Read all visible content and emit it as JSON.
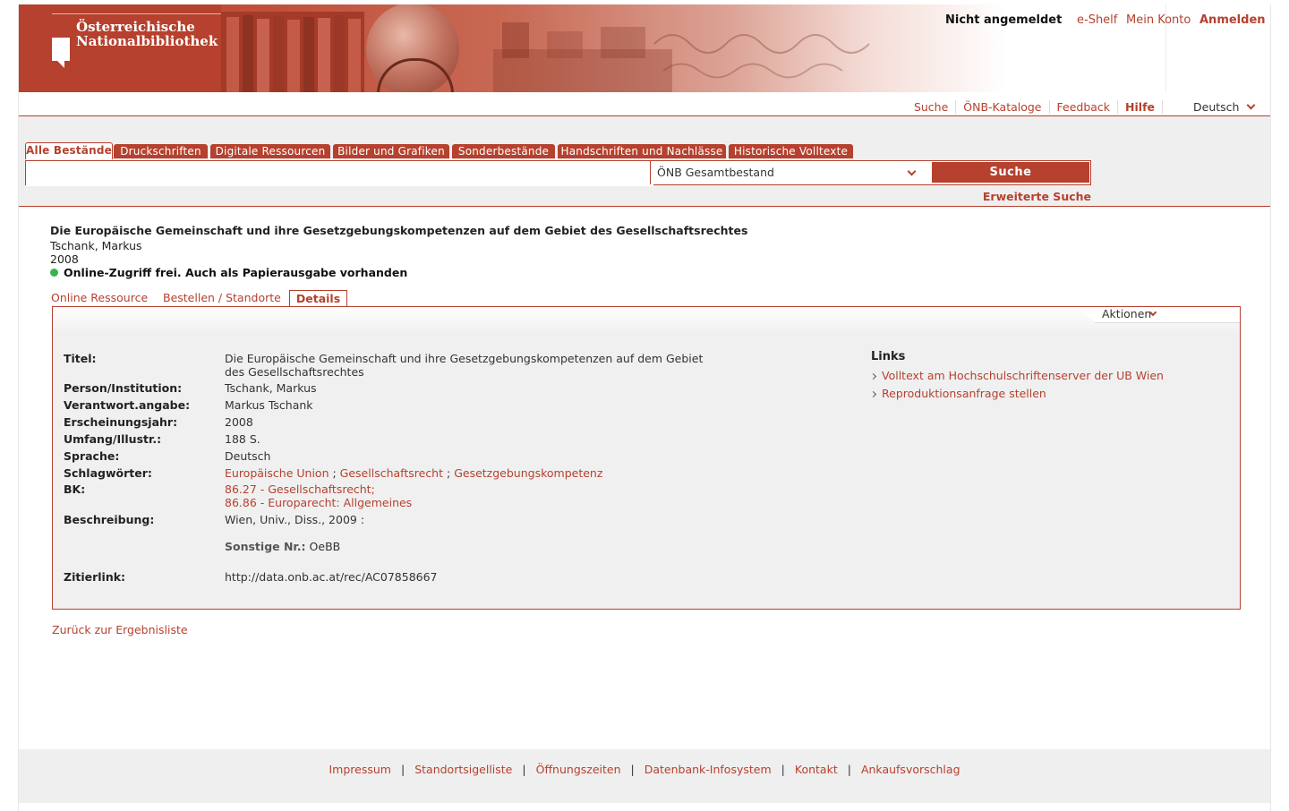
{
  "header": {
    "logo_line1": "Österreichische",
    "logo_line2": "Nationalbibliothek",
    "login_status": "Nicht angemeldet",
    "eshelf": "e-Shelf",
    "account": "Mein Konto",
    "login": "Anmelden"
  },
  "topnav": {
    "items": [
      "Suche",
      "ÖNB-Kataloge",
      "Feedback",
      "Hilfe"
    ],
    "language": "Deutsch"
  },
  "search": {
    "tabs": [
      "Alle Bestände",
      "Druckschriften",
      "Digitale Ressourcen",
      "Bilder und Grafiken",
      "Sonderbestände",
      "Handschriften und Nachlässe",
      "Historische Volltexte"
    ],
    "query": "",
    "scope": "ÖNB Gesamtbestand",
    "button": "Suche",
    "advanced": "Erweiterte Suche"
  },
  "record": {
    "title": "Die Europäische Gemeinschaft und ihre Gesetzgebungskompetenzen auf dem Gebiet des Gesellschaftsrechtes",
    "author": "Tschank, Markus",
    "year": "2008",
    "availability": "Online-Zugriff frei. Auch als Papierausgabe vorhanden",
    "availability_color": "#3ab54a",
    "subtabs": [
      "Online Ressource",
      "Bestellen / Standorte",
      "Details"
    ]
  },
  "details": {
    "actions": "Aktionen",
    "labels": {
      "title": "Titel:",
      "person": "Person/Institution:",
      "resp": "Verantwort.angabe:",
      "year": "Erscheinungsjahr:",
      "extent": "Umfang/Illustr.:",
      "lang": "Sprache:",
      "subjects": "Schlagwörter:",
      "bk": "BK:",
      "desc": "Beschreibung:",
      "other": "Sonstige Nr.:",
      "cite": "Zitierlink:"
    },
    "values": {
      "title": "Die Europäische Gemeinschaft und ihre Gesetzgebungskompetenzen auf dem Gebiet des Gesellschaftsrechtes",
      "person": "Tschank, Markus",
      "resp": "Markus Tschank",
      "year": "2008",
      "extent": "188 S.",
      "lang": "Deutsch",
      "subjects": [
        "Europäische Union",
        "Gesellschaftsrecht",
        "Gesetzgebungskompetenz"
      ],
      "bk": [
        "86.27 - Gesellschaftsrecht;",
        "86.86 - Europarecht: Allgemeines"
      ],
      "desc": "Wien, Univ., Diss., 2009 :",
      "other": "OeBB",
      "cite": "http://data.onb.ac.at/rec/AC07858667"
    },
    "links_heading": "Links",
    "links": [
      "Volltext am Hochschulschriftenserver der UB Wien",
      "Reproduktionsanfrage stellen"
    ]
  },
  "back": "Zurück zur Ergebnisliste",
  "footer": {
    "links": [
      "Impressum",
      "Standortsigelliste",
      "Öffnungszeiten",
      "Datenbank-Infosystem",
      "Kontakt",
      "Ankaufsvorschlag"
    ],
    "separator": "|"
  },
  "colors": {
    "accent": "#b5412e",
    "panel": "#f0f0f0"
  }
}
